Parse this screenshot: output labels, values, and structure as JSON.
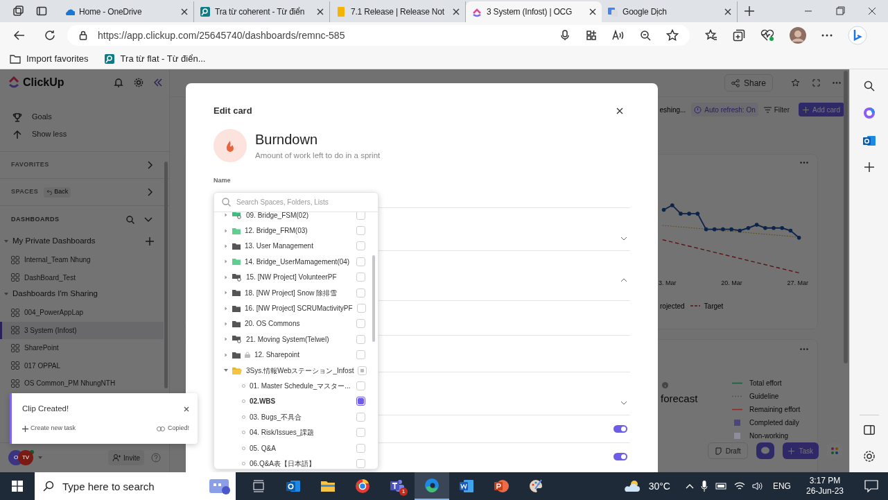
{
  "browser": {
    "tabs": [
      {
        "title": "Home - OneDrive",
        "kind": "onedrive",
        "selected": false
      },
      {
        "title": "Tra từ coherent - Từ điển",
        "kind": "dictionary",
        "selected": false
      },
      {
        "title": "7.1 Release | Release Not",
        "kind": "document",
        "selected": false
      },
      {
        "title": "3 System (Infost) | OCG",
        "kind": "clickup",
        "selected": true
      },
      {
        "title": "Google Dịch",
        "kind": "translate",
        "selected": false
      }
    ],
    "url": "https://app.clickup.com/25645740/dashboards/remnc-585",
    "favorites": [
      {
        "label": "Import favorites",
        "kind": "import"
      },
      {
        "label": "Tra từ flat - Từ điển...",
        "kind": "dictionary"
      }
    ]
  },
  "sidebar": {
    "brand": "ClickUp",
    "nav": [
      {
        "label": "Goals",
        "kind": "trophy"
      },
      {
        "label": "Show less",
        "kind": "arrow-up"
      }
    ],
    "sections": [
      {
        "label": "FAVORITES"
      },
      {
        "label": "SPACES",
        "chip": "Back"
      }
    ],
    "dashboards": {
      "label": "DASHBOARDS",
      "groups": [
        {
          "label": "My Private Dashboards",
          "expanded": true,
          "items": [
            {
              "label": "Internal_Team Nhung",
              "selected": false
            },
            {
              "label": "DashBoard_Test",
              "selected": false
            }
          ]
        },
        {
          "label": "Dashboards I'm Sharing",
          "expanded": true,
          "items": [
            {
              "label": "004_PowerAppLap",
              "selected": false
            },
            {
              "label": "3 System (Infost)",
              "selected": true
            },
            {
              "label": "SharePoint",
              "selected": false
            },
            {
              "label": "017 OPPAL",
              "selected": false
            },
            {
              "label": "OS Common_PM NhungNTH",
              "selected": false
            }
          ]
        }
      ]
    },
    "avatars": [
      {
        "initials": "O",
        "color": "#3b3480"
      },
      {
        "initials": "TV",
        "color": "#7a1a14"
      }
    ],
    "invite": "Invite"
  },
  "dashboard": {
    "share": "Share",
    "refreshing": "eshing...",
    "auto_refresh": "Auto refresh: On",
    "filter": "Filter",
    "add_card": "Add card",
    "chart_card": {
      "x_labels": [
        "3. Mar",
        "20. Mar",
        "27. Mar"
      ],
      "legend": [
        {
          "label": "rojected",
          "kind": "none"
        },
        {
          "label": "Target",
          "kind": "dashed"
        }
      ]
    },
    "forecast_card": {
      "title": "forecast",
      "legend": [
        {
          "label": "Total effort",
          "kind": "solid",
          "color": "#1d5a38"
        },
        {
          "label": "Guideline",
          "kind": "dotted",
          "color": "#555555"
        },
        {
          "label": "Remaining effort",
          "kind": "solid",
          "color": "#8a2a2a"
        },
        {
          "label": "Completed daily",
          "kind": "square",
          "color": "#4a4580"
        },
        {
          "label": "Non-working",
          "kind": "square",
          "color": "#8e8e9a"
        }
      ]
    },
    "draft": "Draft",
    "task": "Task"
  },
  "modal": {
    "heading": "Edit card",
    "card_title": "Burndown",
    "card_subtitle": "Amount of work left to do in a sprint",
    "name_label": "Name",
    "rows": [
      {
        "kind": "select",
        "expanded": false
      },
      {
        "kind": "group",
        "expanded": true
      },
      {
        "kind": "blank"
      },
      {
        "kind": "blank"
      },
      {
        "kind": "select",
        "expanded": false
      },
      {
        "kind": "toggle",
        "on": true
      },
      {
        "kind": "toggle",
        "on": true
      }
    ],
    "picker": {
      "placeholder": "Search Spaces, Folders, Lists",
      "items": [
        {
          "label": "09. Bridge_FSM(02)",
          "kind": "shared-folder",
          "color": "#3fbf7f",
          "checked": false,
          "partial": false
        },
        {
          "label": "12. Bridge_FRM(03)",
          "kind": "folder",
          "color": "#5fcf8f",
          "checked": false,
          "partial": false
        },
        {
          "label": "13. User Management",
          "kind": "folder",
          "color": "#555555",
          "checked": false,
          "partial": false
        },
        {
          "label": "14. Bridge_UserMamagement(04)",
          "kind": "folder",
          "color": "#5fcf8f",
          "checked": false,
          "partial": false
        },
        {
          "label": "15. [NW Project] VolunteerPF",
          "kind": "shared-folder",
          "color": "#555555",
          "checked": false,
          "partial": false
        },
        {
          "label": "18. [NW Project] Snow 除排雪",
          "kind": "folder",
          "color": "#555555",
          "checked": false,
          "partial": false
        },
        {
          "label": "16. [NW Project] SCRUMactivityPF",
          "kind": "folder",
          "color": "#555555",
          "checked": false,
          "partial": false
        },
        {
          "label": "20. OS Commons",
          "kind": "folder",
          "color": "#555555",
          "checked": false,
          "partial": false
        },
        {
          "label": "21. Moving System(Telwel)",
          "kind": "shared-folder",
          "color": "#555555",
          "checked": false,
          "partial": false
        },
        {
          "label": "12. Sharepoint",
          "kind": "folder",
          "color": "#555555",
          "locked": true,
          "checked": false,
          "partial": false
        },
        {
          "label": "3Sys.情報Webステーション_Infost",
          "kind": "folder",
          "color": "#f5c542",
          "expanded": true,
          "checked": false,
          "partial": true,
          "children": [
            {
              "label": "01. Master Schedule_マスター...",
              "kind": "list",
              "checked": false,
              "partial": false
            },
            {
              "label": "02.WBS",
              "kind": "list",
              "checked": true
            },
            {
              "label": "03. Bugs_不具合",
              "kind": "list",
              "checked": false,
              "partial": false
            },
            {
              "label": "04. Risk/Issues_課題",
              "kind": "list",
              "checked": false,
              "partial": false
            },
            {
              "label": "05. Q&A",
              "kind": "list",
              "checked": false,
              "partial": false
            },
            {
              "label": "06.Q&A表【日本語】",
              "kind": "list",
              "checked": false,
              "partial": false
            }
          ]
        }
      ]
    }
  },
  "toast": {
    "title": "Clip Created!",
    "action": "Create new task",
    "status": "Copied!"
  },
  "taskbar": {
    "search_placeholder": "Type here to search",
    "apps": [
      {
        "kind": "taskview",
        "active": false
      },
      {
        "kind": "outlook",
        "active": false
      },
      {
        "kind": "explorer",
        "active": false
      },
      {
        "kind": "browser",
        "active": false
      },
      {
        "kind": "teams",
        "active": false,
        "badge": "1"
      },
      {
        "kind": "edge",
        "active": true
      },
      {
        "kind": "word",
        "active": false
      },
      {
        "kind": "powerpoint",
        "active": false
      },
      {
        "kind": "paint",
        "active": false
      }
    ],
    "weather": "30°C",
    "language": "ENG",
    "time": "3:17 PM",
    "date": "26-Jun-23"
  }
}
